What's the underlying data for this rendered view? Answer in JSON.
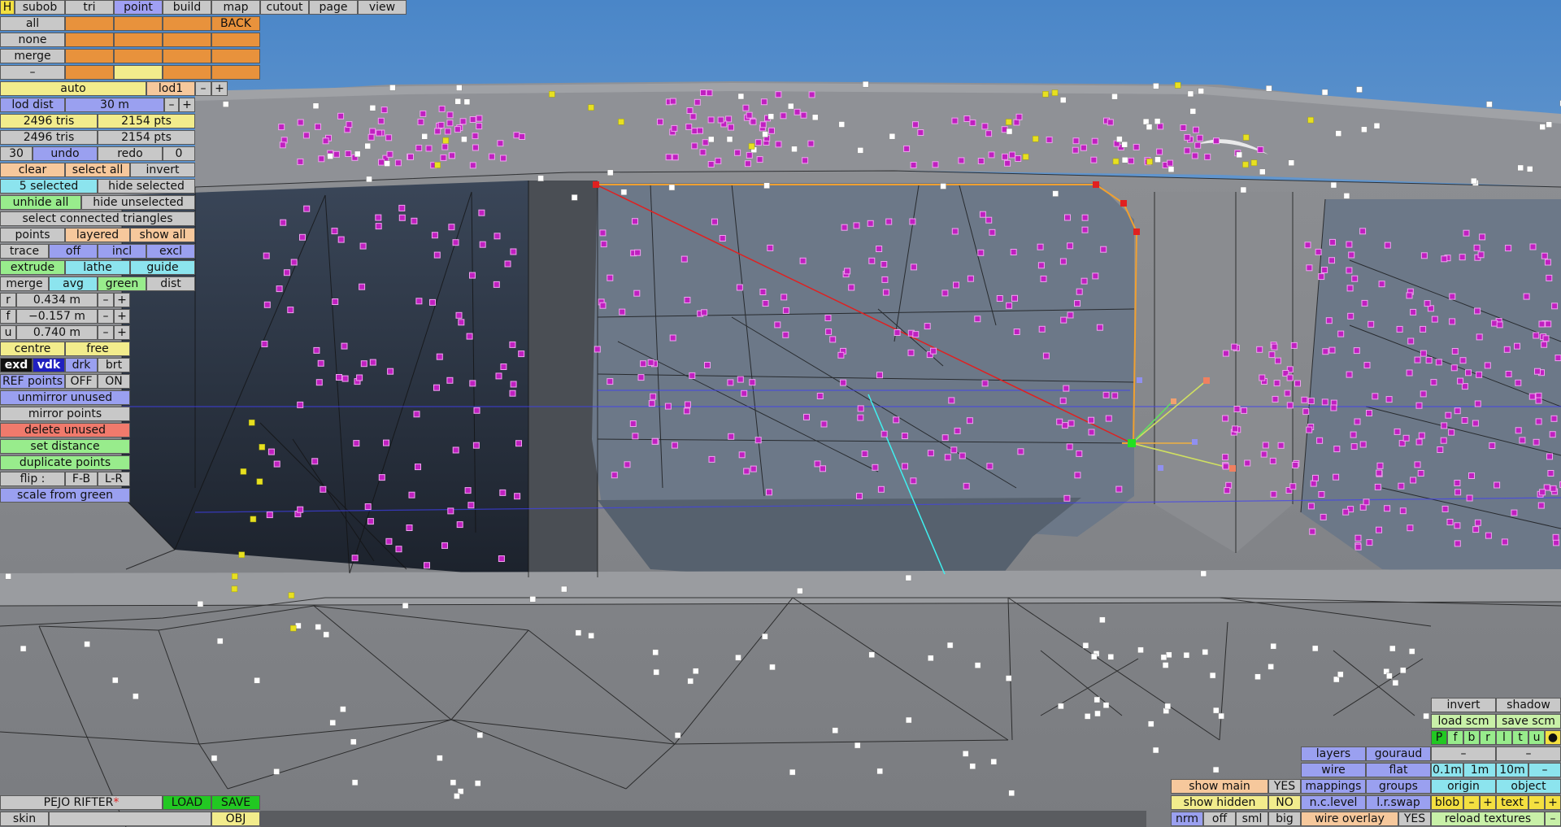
{
  "menu": {
    "h": "H",
    "tabs": [
      "subob",
      "tri",
      "point",
      "build",
      "map",
      "cutout",
      "page",
      "view"
    ],
    "active": "point"
  },
  "sel": {
    "all": "all",
    "none": "none",
    "merge": "merge",
    "dash": "–",
    "back": "BACK"
  },
  "lod": {
    "auto": "auto",
    "lod1": "lod1",
    "minus": "–",
    "plus": "+",
    "dist_label": "lod dist",
    "dist_value": "30 m"
  },
  "stats": {
    "tris1": "2496 tris",
    "pts1": "2154 pts",
    "tris2": "2496 tris",
    "pts2": "2154 pts"
  },
  "undo": {
    "count": "30",
    "undo": "undo",
    "redo": "redo",
    "redo_count": "0"
  },
  "edit": {
    "clear": "clear",
    "select_all": "select all",
    "invert": "invert",
    "selected": "5 selected",
    "hide_selected": "hide selected",
    "unhide_all": "unhide all",
    "hide_unselected": "hide unselected",
    "select_connected": "select connected triangles"
  },
  "mode": {
    "points": "points",
    "layered": "layered",
    "show_all": "show all",
    "trace": "trace",
    "off": "off",
    "incl": "incl",
    "excl": "excl",
    "extrude": "extrude",
    "lathe": "lathe",
    "guide": "guide",
    "merge": "merge",
    "avg": "avg",
    "green": "green",
    "dist": "dist"
  },
  "coords": [
    {
      "axis": "r",
      "value": "0.434 m"
    },
    {
      "axis": "f",
      "value": "−0.157 m"
    },
    {
      "axis": "u",
      "value": "0.740 m"
    }
  ],
  "pivot": {
    "centre": "centre",
    "free": "free"
  },
  "view_mode": {
    "exd": "exd",
    "vdk": "vdk",
    "drk": "drk",
    "brt": "brt"
  },
  "ref": {
    "label": "REF points",
    "off": "OFF",
    "on": "ON"
  },
  "actions": {
    "unmirror": "unmirror unused",
    "mirror": "mirror points",
    "delete": "delete unused",
    "set_distance": "set distance",
    "duplicate": "duplicate points",
    "flip": "flip :",
    "fb": "F-B",
    "lr": "L-R",
    "scale": "scale from green"
  },
  "file": {
    "name": "PEJO RIFTER",
    "modified": "*",
    "load": "LOAD",
    "save": "SAVE",
    "skin": "skin",
    "obj": "OBJ"
  },
  "render": {
    "show_main": "show main",
    "show_main_val": "YES",
    "show_hidden": "show hidden",
    "show_hidden_val": "NO",
    "nrm": "nrm",
    "off": "off",
    "sml": "sml",
    "big": "big",
    "layers": "layers",
    "gouraud": "gouraud",
    "wire": "wire",
    "flat": "flat",
    "mappings": "mappings",
    "groups": "groups",
    "nc_level": "n.c.level",
    "lr_swap": "l.r.swap",
    "wire_overlay": "wire overlay",
    "wire_overlay_val": "YES",
    "invert": "invert",
    "shadow": "shadow",
    "load_scm": "load scm",
    "save_scm": "save scm",
    "views": [
      "P",
      "f",
      "b",
      "r",
      "l",
      "t",
      "u"
    ],
    "dash": "–",
    "grid": [
      "0.1m",
      "1m",
      "10m"
    ],
    "origin": "origin",
    "object": "object",
    "blob": "blob",
    "text": "text",
    "reload": "reload textures"
  },
  "colors": {
    "orange": "#e8923c",
    "magenta": "#c020c0",
    "selected": "#e02020",
    "green": "#22e022"
  }
}
